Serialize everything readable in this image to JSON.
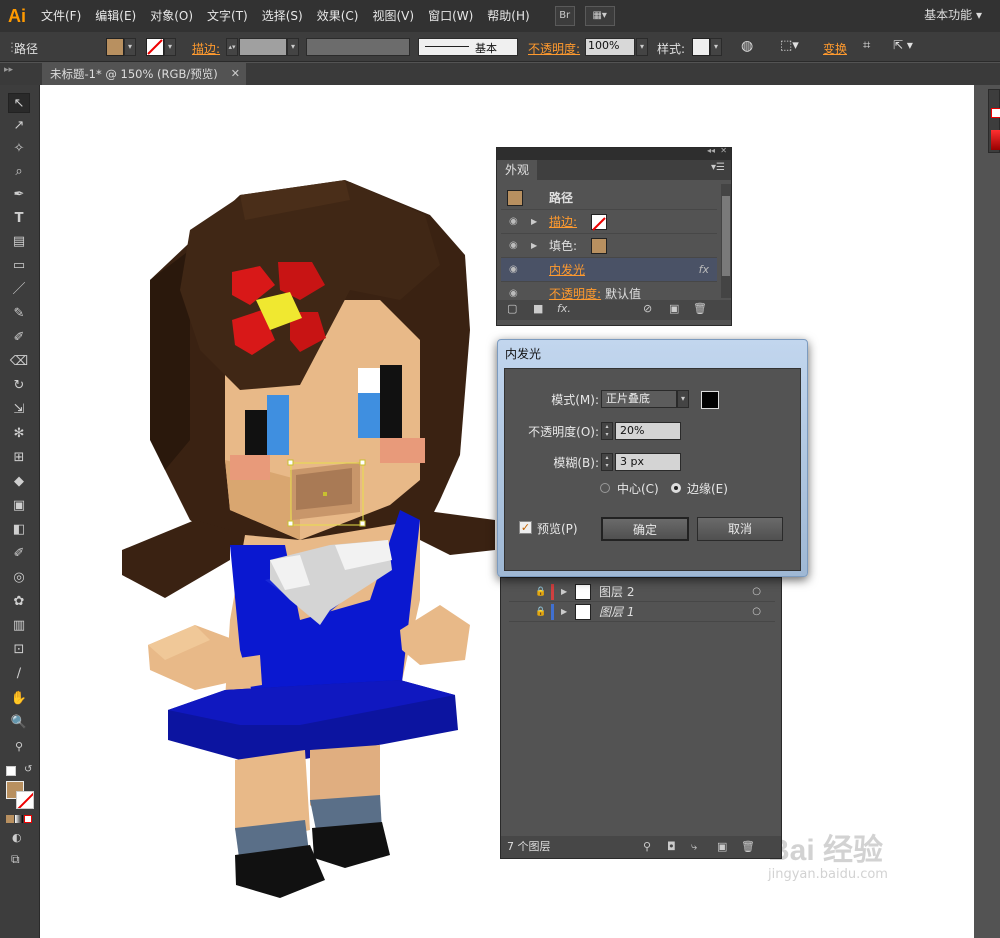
{
  "app": {
    "logo": "Ai"
  },
  "menu": [
    "文件(F)",
    "编辑(E)",
    "对象(O)",
    "文字(T)",
    "选择(S)",
    "效果(C)",
    "视图(V)",
    "窗口(W)",
    "帮助(H)"
  ],
  "menu_buttons": {
    "bridge": "Br",
    "arrange": "▦▾"
  },
  "workspace": "基本功能 ▾",
  "control": {
    "object_type": "路径",
    "stroke_label": "描边:",
    "stroke_style": "基本",
    "opacity_label": "不透明度:",
    "opacity_value": "100%",
    "style_label": "样式:",
    "transform_label": "变换",
    "fill_color": "#b89060"
  },
  "document_tab": {
    "title": "未标题-1* @ 150% (RGB/预览)",
    "close": "✕"
  },
  "tools": [
    "↖",
    "↗",
    "✧",
    "⌕",
    "✒",
    "T",
    "▤",
    "▭",
    "／",
    "✎",
    "✐",
    "⌫",
    "↻",
    "⇲",
    "✻",
    "⊞",
    "◆",
    "▣",
    "◧",
    "✐",
    "◎",
    "✿",
    "▥",
    "⊡",
    "∕",
    "✋",
    "🔍"
  ],
  "appearance_panel": {
    "tab": "外观",
    "title": "路径",
    "rows": [
      {
        "label": "描边:",
        "kind": "stroke"
      },
      {
        "label": "填色:",
        "kind": "fill"
      },
      {
        "label": "内发光",
        "kind": "effect",
        "fx": "fx"
      },
      {
        "label": "不透明度:",
        "value": "默认值",
        "kind": "opacity"
      }
    ],
    "footer_fx": "fx."
  },
  "dialog": {
    "title": "内发光",
    "mode_label": "模式(M):",
    "mode_value": "正片叠底",
    "opacity_label": "不透明度(O):",
    "opacity_value": "20%",
    "blur_label": "模糊(B):",
    "blur_value": "3 px",
    "center_label": "中心(C)",
    "edge_label": "边缘(E)",
    "preview_label": "预览(P)",
    "ok_label": "确定",
    "cancel_label": "取消",
    "glow_color": "#000000"
  },
  "layers_panel": {
    "layers": [
      {
        "name": "图层 2",
        "color": "#d04040"
      },
      {
        "name": "图层 1",
        "color": "#4070d0"
      }
    ],
    "count": "7 个图层"
  },
  "watermark": {
    "brand": "Bai 经验",
    "url": "jingyan.baidu.com"
  }
}
